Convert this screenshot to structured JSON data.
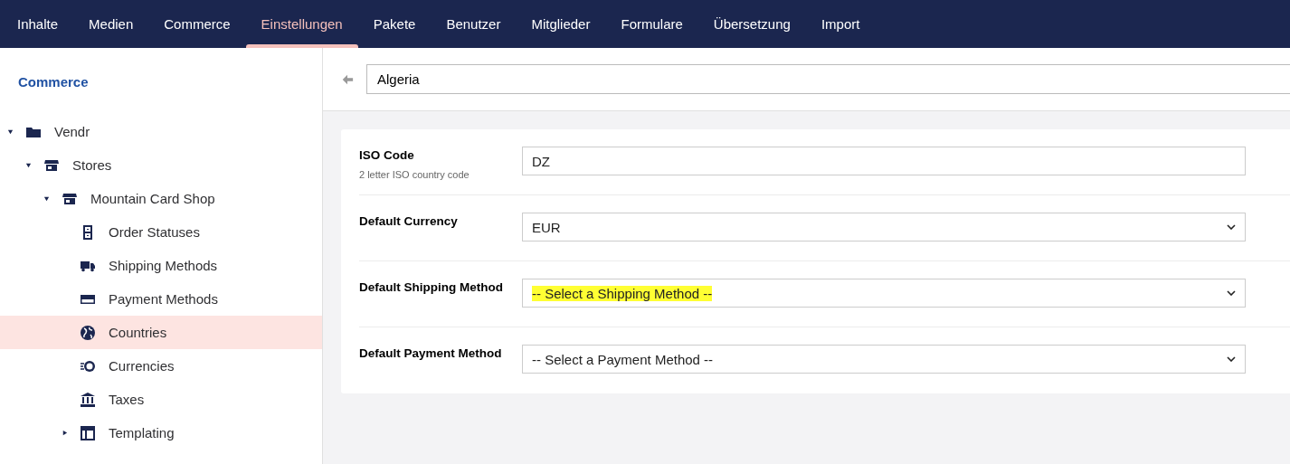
{
  "top_nav": [
    {
      "label": "Inhalte",
      "selected": false
    },
    {
      "label": "Medien",
      "selected": false
    },
    {
      "label": "Commerce",
      "selected": false
    },
    {
      "label": "Einstellungen",
      "selected": true
    },
    {
      "label": "Pakete",
      "selected": false
    },
    {
      "label": "Benutzer",
      "selected": false
    },
    {
      "label": "Mitglieder",
      "selected": false
    },
    {
      "label": "Formulare",
      "selected": false
    },
    {
      "label": "Übersetzung",
      "selected": false
    },
    {
      "label": "Import",
      "selected": false
    }
  ],
  "sidebar": {
    "title": "Commerce",
    "tree": [
      {
        "label": "Vendr",
        "kind": "folder",
        "expanded": true,
        "selected": false,
        "children": [
          {
            "label": "Stores",
            "kind": "store",
            "expanded": true,
            "selected": false,
            "children": [
              {
                "label": "Mountain Card Shop",
                "kind": "store",
                "expanded": true,
                "selected": false,
                "children": [
                  {
                    "label": "Order Statuses",
                    "kind": "cabinet",
                    "selected": false
                  },
                  {
                    "label": "Shipping Methods",
                    "kind": "truck",
                    "selected": false
                  },
                  {
                    "label": "Payment Methods",
                    "kind": "card",
                    "selected": false
                  },
                  {
                    "label": "Countries",
                    "kind": "globe",
                    "selected": true
                  },
                  {
                    "label": "Currencies",
                    "kind": "coin",
                    "selected": false
                  },
                  {
                    "label": "Taxes",
                    "kind": "bank",
                    "selected": false
                  },
                  {
                    "label": "Templating",
                    "kind": "layout",
                    "expanded": false,
                    "selected": false
                  }
                ]
              }
            ]
          }
        ]
      }
    ]
  },
  "editor": {
    "name": "Algeria",
    "fields": [
      {
        "label": "ISO Code",
        "description": "2 letter ISO country code",
        "kind": "text",
        "value": "DZ",
        "highlighted": false
      },
      {
        "label": "Default Currency",
        "kind": "select",
        "value": "EUR",
        "highlighted": false
      },
      {
        "label": "Default Shipping Method",
        "kind": "select",
        "value": "-- Select a Shipping Method --",
        "highlighted": true
      },
      {
        "label": "Default Payment Method",
        "kind": "select",
        "value": "-- Select a Payment Method --",
        "highlighted": false
      }
    ]
  }
}
